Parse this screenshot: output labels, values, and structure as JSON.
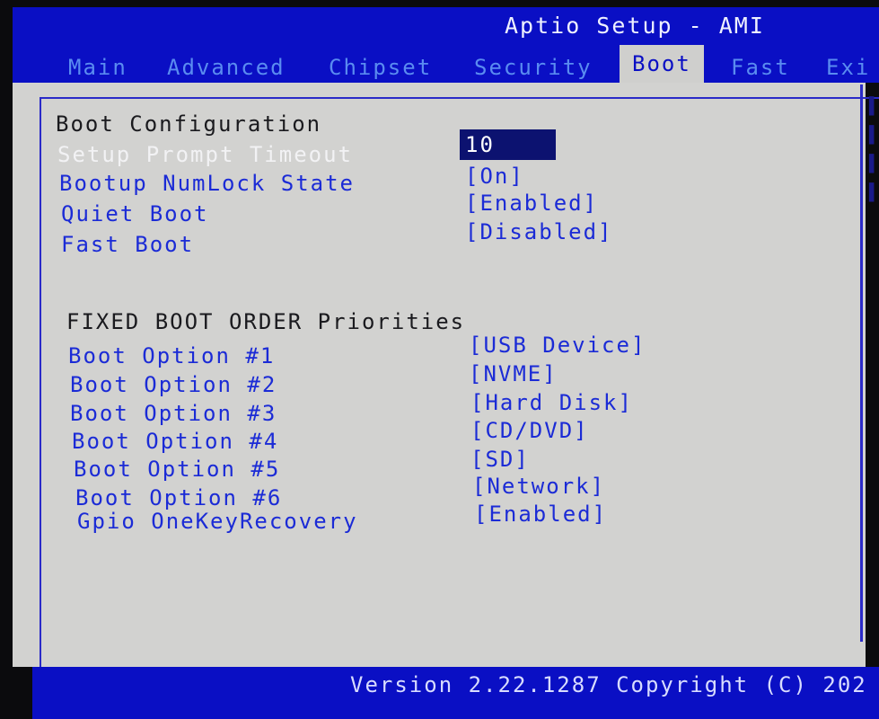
{
  "header": {
    "title": "Aptio Setup - AMI",
    "tabs": [
      "Main",
      "Advanced",
      "Chipset",
      "Security",
      "Boot",
      "Fast",
      "Exi"
    ],
    "active_tab": "Boot"
  },
  "boot_config": {
    "heading": "Boot Configuration",
    "items": [
      {
        "label": "Setup Prompt Timeout",
        "value": "10"
      },
      {
        "label": "Bootup NumLock State",
        "value": "[On]"
      },
      {
        "label": "Quiet Boot",
        "value": "[Enabled]"
      },
      {
        "label": "Fast Boot",
        "value": "[Disabled]"
      }
    ]
  },
  "boot_order": {
    "heading": "FIXED BOOT ORDER Priorities",
    "items": [
      {
        "label": "Boot Option #1",
        "value": "[USB Device]"
      },
      {
        "label": "Boot Option #2",
        "value": "[NVME]"
      },
      {
        "label": "Boot Option #3",
        "value": "[Hard Disk]"
      },
      {
        "label": "Boot Option #4",
        "value": "[CD/DVD]"
      },
      {
        "label": "Boot Option #5",
        "value": "[SD]"
      },
      {
        "label": "Boot Option #6",
        "value": "[Network]"
      },
      {
        "label": "Gpio OneKeyRecovery",
        "value": "[Enabled]"
      }
    ]
  },
  "footer": {
    "text": "Version 2.22.1287 Copyright (C) 202"
  },
  "colors": {
    "header_blue": "#0a0fc4",
    "panel_grey": "#d2d2d0",
    "item_blue": "#1b2bd6",
    "selected_bg": "#0c1270"
  }
}
